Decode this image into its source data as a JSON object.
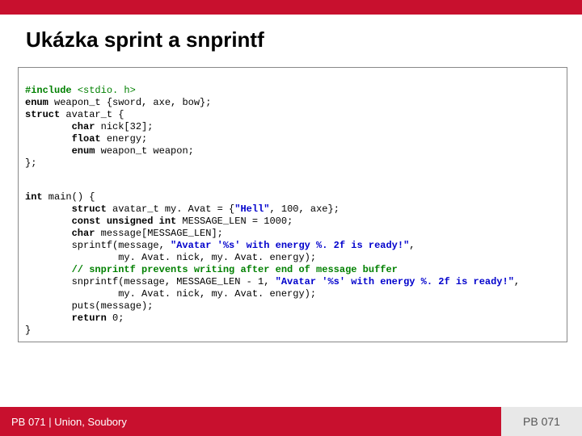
{
  "title": "Ukázka sprint a snprintf",
  "footer": {
    "left": "PB 071 | Union, Soubory",
    "right": "PB 071"
  },
  "code": {
    "l01a": "#include ",
    "l01b": "<stdio. h>",
    "l02a": "enum",
    "l02b": " weapon_t {sword, axe, bow};",
    "l03a": "struct",
    "l03b": " avatar_t {",
    "l04a": "        ",
    "l04b": "char",
    "l04c": " nick[",
    "l04d": "32",
    "l04e": "];",
    "l05a": "        ",
    "l05b": "float",
    "l05c": " energy;",
    "l06a": "        ",
    "l06b": "enum",
    "l06c": " weapon_t weapon;",
    "l07": "};",
    "l08a": "int",
    "l08b": " main() {",
    "l09a": "        ",
    "l09b": "struct",
    "l09c": " avatar_t my. Avat = {",
    "l09d": "\"Hell\"",
    "l09e": ", ",
    "l09f": "100",
    "l09g": ", axe};",
    "l10a": "        ",
    "l10b": "const unsigned int",
    "l10c": " MESSAGE_LEN = ",
    "l10d": "1000",
    "l10e": ";",
    "l11a": "        ",
    "l11b": "char",
    "l11c": " message[MESSAGE_LEN];",
    "l12a": "        sprintf(message, ",
    "l12b": "\"Avatar '%s' with energy %. 2f is ready!\"",
    "l12c": ",",
    "l13": "                my. Avat. nick, my. Avat. energy);",
    "l14a": "        ",
    "l14b": "// snprintf prevents writing after end of message buffer",
    "l15a": "        snprintf(message, MESSAGE_LEN - ",
    "l15b": "1",
    "l15c": ", ",
    "l15d": "\"Avatar '%s' with energy %. 2f is ready!\"",
    "l15e": ",",
    "l16": "                my. Avat. nick, my. Avat. energy);",
    "l17": "        puts(message);",
    "l18a": "        ",
    "l18b": "return",
    "l18c": " ",
    "l18d": "0",
    "l18e": ";",
    "l19": "}"
  }
}
